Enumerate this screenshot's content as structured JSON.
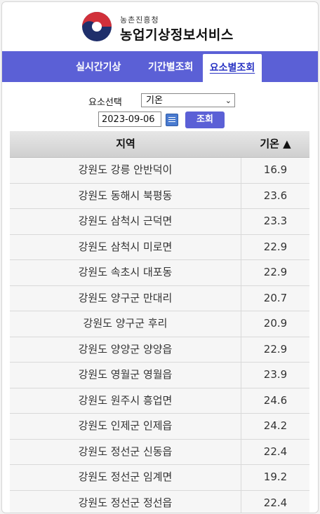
{
  "header": {
    "org_sub": "농촌진흥청",
    "org_name": "농업기상정보서비스",
    "colors": {
      "red": "#d1303a",
      "navy": "#1f2f6b",
      "tab_bg": "#5b60d6"
    }
  },
  "tabs": [
    {
      "label": "실시간기상",
      "active": false
    },
    {
      "label": "기간별조회",
      "active": false
    },
    {
      "label": "요소별조회",
      "active": true
    }
  ],
  "filters": {
    "element_label": "요소선택",
    "element_value": "기온",
    "date_value": "2023-09-06",
    "search_label": "조회"
  },
  "table": {
    "col_region": "지역",
    "col_temp": "기온 ▲",
    "rows": [
      {
        "region": "강원도 강릉 안반덕이",
        "temp": "16.9"
      },
      {
        "region": "강원도 동해시 북평동",
        "temp": "23.6"
      },
      {
        "region": "강원도 삼척시 근덕면",
        "temp": "23.3"
      },
      {
        "region": "강원도 삼척시 미로면",
        "temp": "22.9"
      },
      {
        "region": "강원도 속초시 대포동",
        "temp": "22.9"
      },
      {
        "region": "강원도 양구군 만대리",
        "temp": "20.7"
      },
      {
        "region": "강원도 양구군 후리",
        "temp": "20.9"
      },
      {
        "region": "강원도 양양군 양양읍",
        "temp": "22.9"
      },
      {
        "region": "강원도 영월군 영월읍",
        "temp": "23.9"
      },
      {
        "region": "강원도 원주시 흥업면",
        "temp": "24.6"
      },
      {
        "region": "강원도 인제군 인제읍",
        "temp": "24.2"
      },
      {
        "region": "강원도 정선군 신동읍",
        "temp": "22.4"
      },
      {
        "region": "강원도 정선군 임계면",
        "temp": "19.2"
      },
      {
        "region": "강원도 정선군 정선읍",
        "temp": "22.4"
      }
    ]
  }
}
